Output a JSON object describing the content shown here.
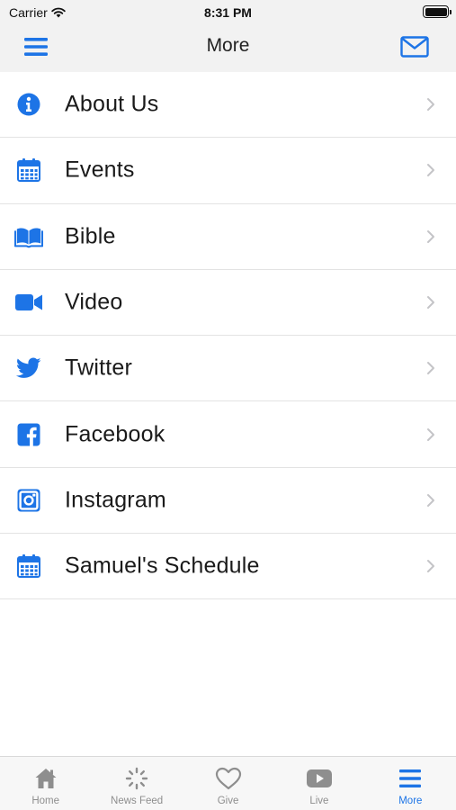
{
  "status_bar": {
    "carrier": "Carrier",
    "time": "8:31 PM"
  },
  "navbar": {
    "title": "More",
    "menu_icon": "hamburger-menu-icon",
    "mail_icon": "envelope-icon"
  },
  "colors": {
    "accent": "#1d74e6",
    "inactive": "#8e8e8e",
    "bar_background": "#f2f2f2",
    "divider": "#e3e3e3"
  },
  "menu_items": [
    {
      "label": "About Us",
      "icon": "info-circle-icon"
    },
    {
      "label": "Events",
      "icon": "calendar-icon"
    },
    {
      "label": "Bible",
      "icon": "open-book-icon"
    },
    {
      "label": "Video",
      "icon": "video-camera-icon"
    },
    {
      "label": "Twitter",
      "icon": "twitter-bird-icon"
    },
    {
      "label": "Facebook",
      "icon": "facebook-icon"
    },
    {
      "label": "Instagram",
      "icon": "instagram-icon"
    },
    {
      "label": "Samuel's Schedule",
      "icon": "calendar-icon"
    }
  ],
  "tabs": [
    {
      "label": "Home",
      "icon": "home-icon",
      "active": false
    },
    {
      "label": "News Feed",
      "icon": "refresh-icon",
      "active": false
    },
    {
      "label": "Give",
      "icon": "heart-icon",
      "active": false
    },
    {
      "label": "Live",
      "icon": "play-icon",
      "active": false
    },
    {
      "label": "More",
      "icon": "hamburger-menu-icon",
      "active": true
    }
  ]
}
